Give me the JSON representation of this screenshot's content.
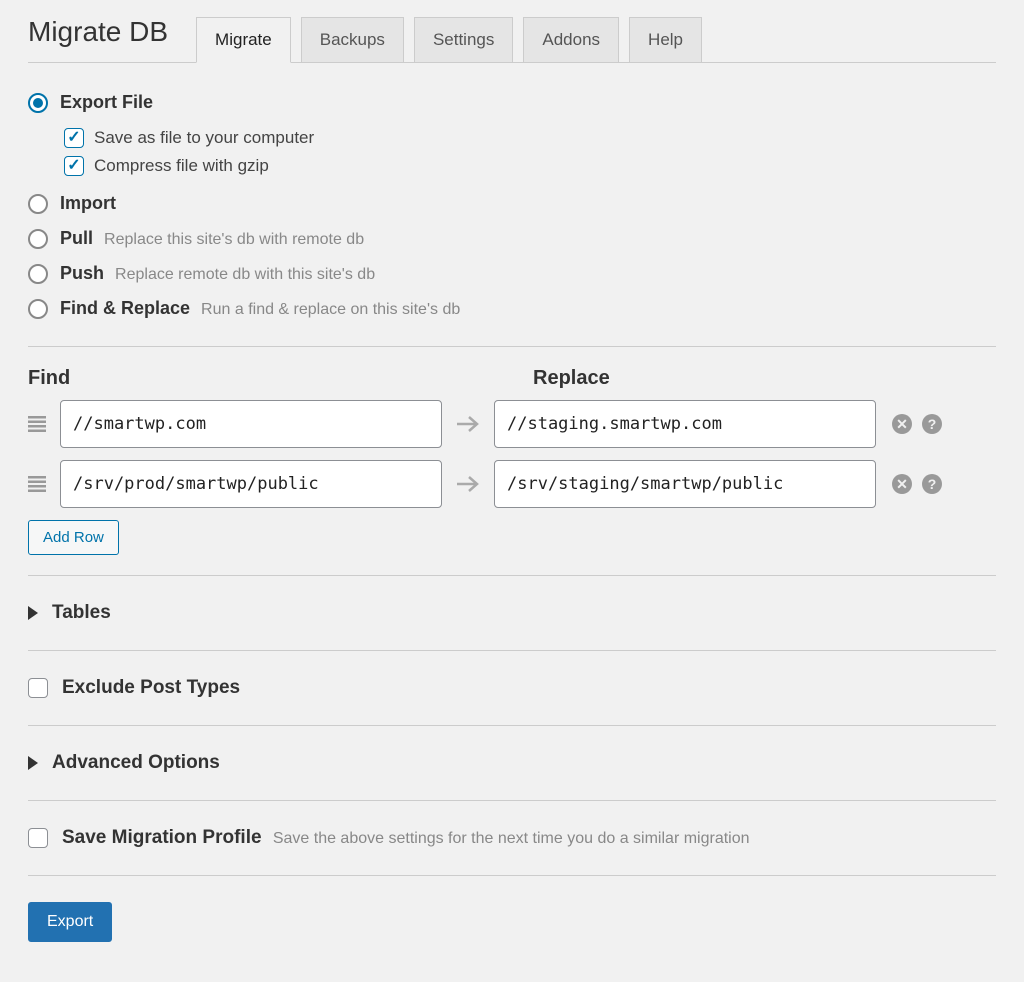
{
  "header": {
    "title": "Migrate DB"
  },
  "tabs": [
    {
      "label": "Migrate",
      "active": true
    },
    {
      "label": "Backups",
      "active": false
    },
    {
      "label": "Settings",
      "active": false
    },
    {
      "label": "Addons",
      "active": false
    },
    {
      "label": "Help",
      "active": false
    }
  ],
  "modes": [
    {
      "name": "export",
      "label": "Export File",
      "hint": "",
      "checked": true
    },
    {
      "name": "import",
      "label": "Import",
      "hint": "",
      "checked": false
    },
    {
      "name": "pull",
      "label": "Pull",
      "hint": "Replace this site's db with remote db",
      "checked": false
    },
    {
      "name": "push",
      "label": "Push",
      "hint": "Replace remote db with this site's db",
      "checked": false
    },
    {
      "name": "find-replace",
      "label": "Find & Replace",
      "hint": "Run a find & replace on this site's db",
      "checked": false
    }
  ],
  "export_sub": [
    {
      "label": "Save as file to your computer",
      "checked": true
    },
    {
      "label": "Compress file with gzip",
      "checked": true
    }
  ],
  "find_replace": {
    "find_label": "Find",
    "replace_label": "Replace",
    "rows": [
      {
        "find": "//smartwp.com",
        "replace": "//staging.smartwp.com"
      },
      {
        "find": "/srv/prod/smartwp/public",
        "replace": "/srv/staging/smartwp/public"
      }
    ],
    "add_row_label": "Add Row"
  },
  "sections": {
    "tables": {
      "label": "Tables"
    },
    "exclude_post_types": {
      "label": "Exclude Post Types"
    },
    "advanced": {
      "label": "Advanced Options"
    },
    "save_profile": {
      "label": "Save Migration Profile",
      "hint": "Save the above settings for the next time you do a similar migration"
    }
  },
  "buttons": {
    "export": "Export"
  }
}
